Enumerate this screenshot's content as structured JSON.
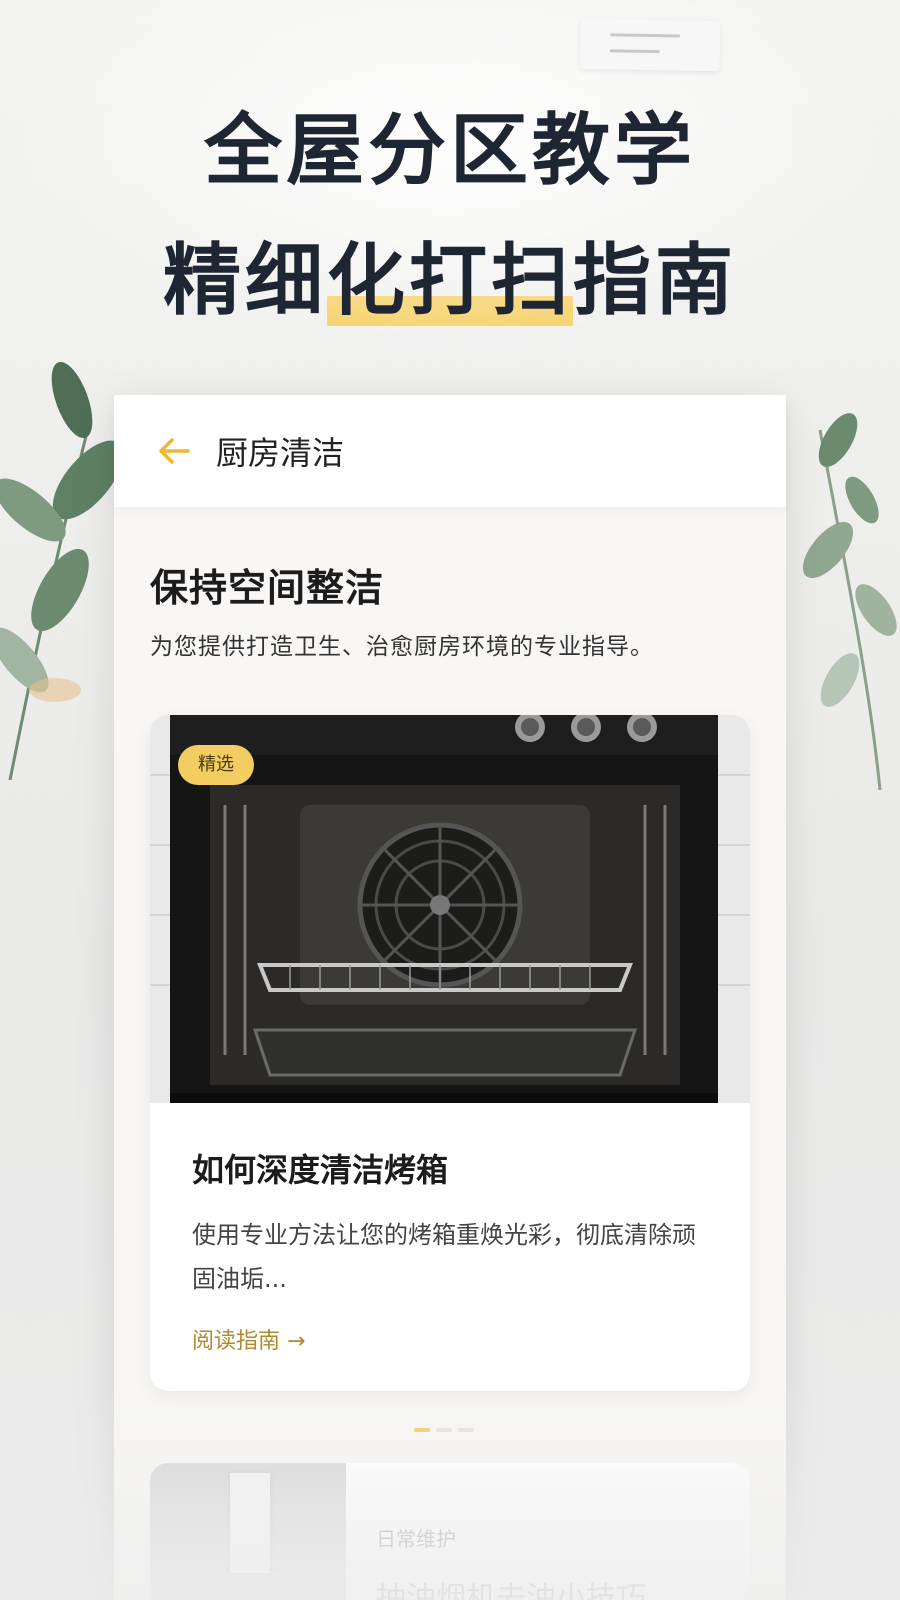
{
  "hero": {
    "line1": "全屋分区教学",
    "line2_plain": "精细",
    "line2_highlight": "化打扫",
    "line2_tail": "指南",
    "highlight_color": "#f6cf62"
  },
  "topbar": {
    "back_icon": "arrow-left-icon",
    "title": "厨房清洁"
  },
  "section": {
    "title": "保持空间整洁",
    "subtitle": "为您提供打造卫生、治愈厨房环境的专业指导。"
  },
  "featured_article": {
    "badge": "精选",
    "title": "如何深度清洁烤箱",
    "description": "使用专业方法让您的烤箱重焕光彩，彻底清除顽固油垢...",
    "link": "阅读指南 →",
    "image": "oven-interior"
  },
  "pager": {
    "count": 3,
    "active": 0
  },
  "next_article": {
    "tag": "日常维护",
    "title": "抽油烟机去油小技巧"
  },
  "colors": {
    "accent": "#f3cd62",
    "link": "#b08a2e",
    "title_dark": "#1f2633"
  }
}
